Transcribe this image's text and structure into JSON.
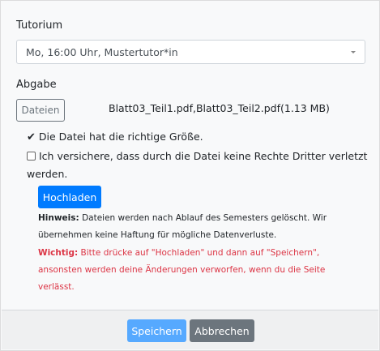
{
  "tutorium": {
    "label": "Tutorium",
    "selected": "Mo, 16:00 Uhr, Mustertutor*in"
  },
  "abgabe": {
    "label": "Abgabe",
    "files_button": "Dateien",
    "files": "Blatt03_Teil1.pdf,Blatt03_Teil2.pdf(1.13 MB)"
  },
  "size_ok": "Die Datei hat die richtige Größe.",
  "consent": {
    "line1": "Ich versichere, dass durch die Datei keine Rechte Dritter verletzt",
    "line2": "werden.",
    "checked": false
  },
  "upload_button": "Hochladen",
  "hint": {
    "label": "Hinweis:",
    "line1": " Dateien werden nach Ablauf des Semesters gelöscht. Wir",
    "line2": "übernehmen keine Haftung für mögliche Datenverluste."
  },
  "important": {
    "label": "Wichtig:",
    "line1": " Bitte drücke auf \"Hochladen\" und dann auf \"Speichern\",",
    "line2": "ansonsten werden deine Änderungen verworfen, wenn du die Seite",
    "line3": "verlässt."
  },
  "footer": {
    "save": "Speichern",
    "cancel": "Abbrechen"
  },
  "colors": {
    "primary": "#007bff",
    "save_disabled": "#56a9ff",
    "secondary": "#6c757d",
    "danger": "#dc3545"
  }
}
